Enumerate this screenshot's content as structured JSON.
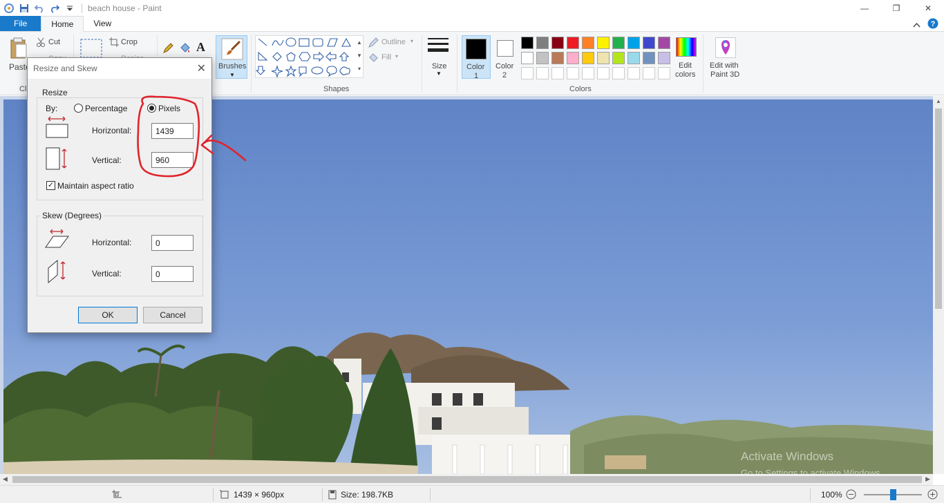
{
  "window": {
    "title": "beach house - Paint",
    "controls": {
      "minimize": "—",
      "maximize": "❐",
      "close": "✕"
    }
  },
  "tabs": {
    "file": "File",
    "home": "Home",
    "view": "View"
  },
  "ribbon": {
    "clipboard": {
      "paste": "Paste",
      "cut": "Cut",
      "copy": "Copy",
      "group_label": "Cli"
    },
    "image": {
      "crop": "Crop",
      "resize": "Resize"
    },
    "brushes": "Brushes",
    "shapes": {
      "outline": "Outline",
      "fill": "Fill",
      "group_label": "Shapes"
    },
    "size": "Size",
    "color1": {
      "line1": "Color",
      "line2": "1"
    },
    "color2": {
      "line1": "Color",
      "line2": "2"
    },
    "colors_label": "Colors",
    "edit_colors": {
      "line1": "Edit",
      "line2": "colors"
    },
    "paint3d": {
      "line1": "Edit with",
      "line2": "Paint 3D"
    },
    "palette_row1": [
      "#000000",
      "#7f7f7f",
      "#880015",
      "#ed1c24",
      "#ff7f27",
      "#fff200",
      "#22b14c",
      "#00a2e8",
      "#3f48cc",
      "#a349a4"
    ],
    "palette_row2": [
      "#ffffff",
      "#c3c3c3",
      "#b97a57",
      "#ffaec9",
      "#ffc90e",
      "#efe4b0",
      "#b5e61d",
      "#99d9ea",
      "#7092be",
      "#c8bfe7"
    ]
  },
  "dialog": {
    "title": "Resize and Skew",
    "resize": {
      "legend": "Resize",
      "by": "By:",
      "percentage": "Percentage",
      "pixels": "Pixels",
      "horizontal_label": "Horizontal:",
      "horizontal_value": "1439",
      "vertical_label": "Vertical:",
      "vertical_value": "960",
      "maintain": "Maintain aspect ratio"
    },
    "skew": {
      "legend": "Skew (Degrees)",
      "horizontal_label": "Horizontal:",
      "horizontal_value": "0",
      "vertical_label": "Vertical:",
      "vertical_value": "0"
    },
    "ok": "OK",
    "cancel": "Cancel"
  },
  "watermark": {
    "line1": "Activate Windows",
    "line2": "Go to Settings to activate Windows."
  },
  "status": {
    "dimensions": "1439 × 960px",
    "size": "Size: 198.7KB",
    "zoom": "100%"
  }
}
